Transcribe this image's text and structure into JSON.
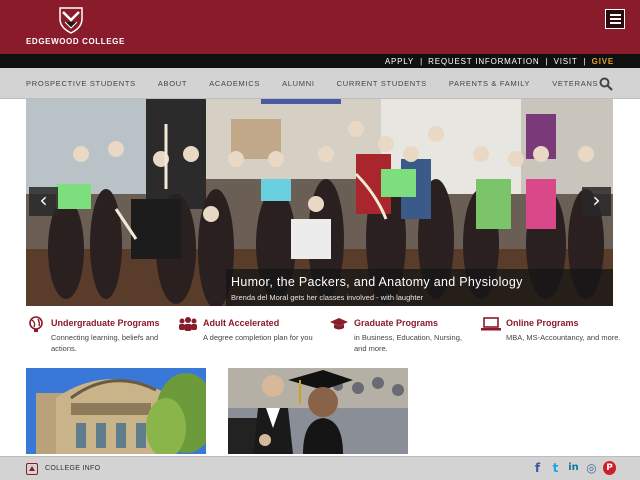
{
  "header": {
    "logo_text": "EDGEWOOD COLLEGE",
    "menu_icon": "hamburger-menu-icon",
    "brand_color": "#8a1b2a"
  },
  "utility_nav": {
    "links": [
      "APPLY",
      "REQUEST INFORMATION",
      "VISIT",
      "GIVE"
    ],
    "give_color": "#e2a129"
  },
  "main_nav": {
    "items": [
      "PROSPECTIVE STUDENTS",
      "ABOUT",
      "ACADEMICS",
      "ALUMNI",
      "CURRENT STUDENTS",
      "PARENTS & FAMILY",
      "VETERANS"
    ],
    "search_icon": "search-icon"
  },
  "hero": {
    "title": "Humor, the Packers, and Anatomy and Physiology",
    "subtitle": "Brenda del Moral gets her classes involved - with laughter",
    "prev_icon": "chevron-left-icon",
    "next_icon": "chevron-right-icon",
    "prev_glyph": "‹",
    "next_glyph": "›"
  },
  "programs": [
    {
      "title": "Undergraduate Programs",
      "desc": "Connecting learning, beliefs and actions.",
      "icon": "globe-icon"
    },
    {
      "title": "Adult Accelerated",
      "desc": "A degree completion plan for you",
      "icon": "people-icon"
    },
    {
      "title": "Graduate Programs",
      "desc": "in Business, Education, Nursing, and more.",
      "icon": "graduation-cap-icon"
    },
    {
      "title": "Online Programs",
      "desc": "MBA, MS-Accountancy, and more.",
      "icon": "laptop-icon"
    }
  ],
  "footer": {
    "info_label": "COLLEGE INFO",
    "info_icon": "info-toggle-icon",
    "socials": [
      {
        "name": "facebook-icon",
        "glyph": "f",
        "color": "#3b5998"
      },
      {
        "name": "twitter-icon",
        "glyph": "t",
        "color": "#1da1f2"
      },
      {
        "name": "linkedin-icon",
        "glyph": "in",
        "color": "#0e76a8"
      },
      {
        "name": "instagram-icon",
        "glyph": "◎",
        "color": "#3f729b"
      },
      {
        "name": "pinterest-icon",
        "glyph": "P",
        "color": "#cb2027"
      }
    ]
  }
}
